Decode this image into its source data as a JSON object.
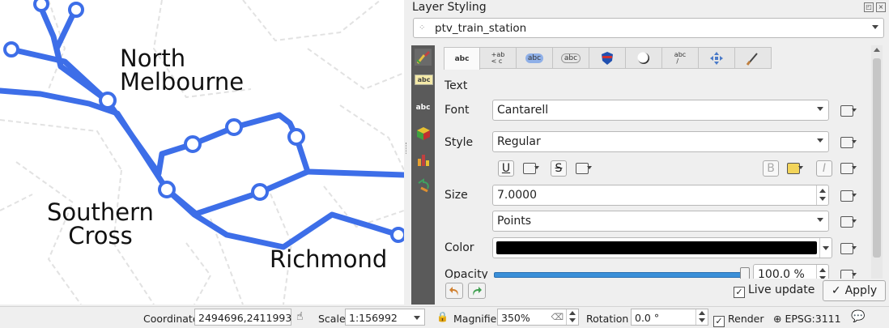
{
  "map": {
    "labels": {
      "north_melbourne": "North\nMelbourne",
      "southern_cross": "Southern\nCross",
      "richmond": "Richmond"
    },
    "line_color": "#3d6ee8"
  },
  "dock": {
    "title": "Layer Styling",
    "layer_name": "ptv_train_station",
    "tabs": [
      "abc",
      "+ab <c",
      "abc",
      "abc",
      "shield",
      "shadow",
      "abc /",
      "placement",
      "rendering"
    ],
    "active_tab": 0,
    "section_title": "Text",
    "font_label": "Font",
    "font_value": "Cantarell",
    "style_label": "Style",
    "style_value": "Regular",
    "underline_label": "U",
    "strike_label": "S",
    "bold_label": "B",
    "italic_label": "I",
    "size_label": "Size",
    "size_value": "7.0000",
    "unit_value": "Points",
    "color_label": "Color",
    "color_value": "#000000",
    "opacity_label": "Opacity",
    "opacity_value": "100.0 %",
    "live_update_label": "Live update",
    "live_update_checked": true,
    "apply_label": "Apply"
  },
  "status": {
    "coordinate_label": "Coordinate",
    "coordinate_value": "2494696,2411993",
    "scale_label": "Scale",
    "scale_value": "1:156992",
    "magnifier_label": "Magnifier",
    "magnifier_value": "350%",
    "rotation_label": "Rotation",
    "rotation_value": "0.0 °",
    "render_label": "Render",
    "render_checked": true,
    "crs_value": "EPSG:3111"
  }
}
